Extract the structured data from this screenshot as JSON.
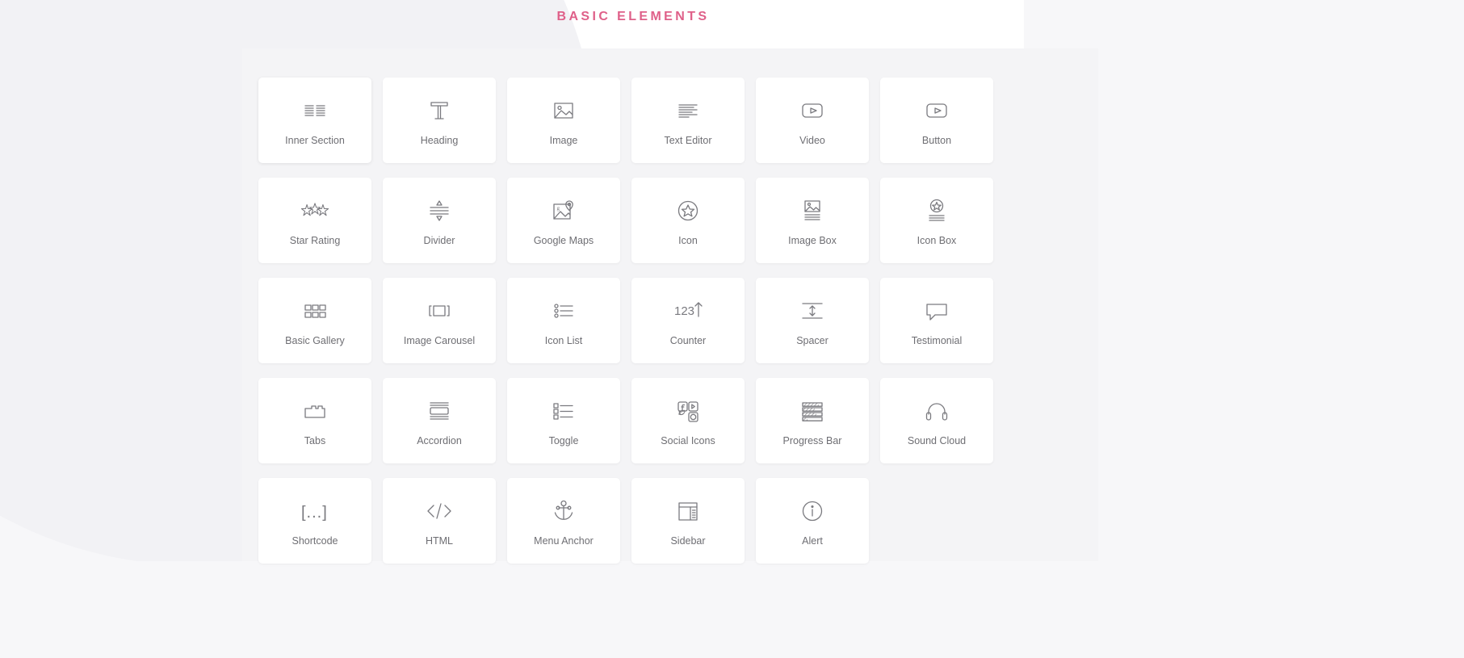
{
  "header": {
    "title": "BASIC ELEMENTS",
    "title_color": "#df6089"
  },
  "theme": {
    "card_background": "#ffffff",
    "page_background": "#f7f7f9",
    "label_color": "#6e6e73",
    "icon_color": "#7a7a7f"
  },
  "grid": {
    "columns": 6,
    "rows": 5,
    "items": [
      {
        "label": "Inner Section",
        "icon": "inner-section-icon"
      },
      {
        "label": "Heading",
        "icon": "heading-icon"
      },
      {
        "label": "Image",
        "icon": "image-icon"
      },
      {
        "label": "Text Editor",
        "icon": "text-editor-icon"
      },
      {
        "label": "Video",
        "icon": "video-icon"
      },
      {
        "label": "Button",
        "icon": "button-icon"
      },
      {
        "label": "Star Rating",
        "icon": "star-rating-icon"
      },
      {
        "label": "Divider",
        "icon": "divider-icon"
      },
      {
        "label": "Google Maps",
        "icon": "google-maps-icon"
      },
      {
        "label": "Icon",
        "icon": "icon-star-circle-icon"
      },
      {
        "label": "Image Box",
        "icon": "image-box-icon"
      },
      {
        "label": "Icon Box",
        "icon": "icon-box-icon"
      },
      {
        "label": "Basic Gallery",
        "icon": "basic-gallery-icon"
      },
      {
        "label": "Image Carousel",
        "icon": "image-carousel-icon"
      },
      {
        "label": "Icon List",
        "icon": "icon-list-icon"
      },
      {
        "label": "Counter",
        "icon": "counter-icon"
      },
      {
        "label": "Spacer",
        "icon": "spacer-icon"
      },
      {
        "label": "Testimonial",
        "icon": "testimonial-icon"
      },
      {
        "label": "Tabs",
        "icon": "tabs-icon"
      },
      {
        "label": "Accordion",
        "icon": "accordion-icon"
      },
      {
        "label": "Toggle",
        "icon": "toggle-icon"
      },
      {
        "label": "Social Icons",
        "icon": "social-icons-icon"
      },
      {
        "label": "Progress Bar",
        "icon": "progress-bar-icon"
      },
      {
        "label": "Sound Cloud",
        "icon": "sound-cloud-icon"
      },
      {
        "label": "Shortcode",
        "icon": "shortcode-icon"
      },
      {
        "label": "HTML",
        "icon": "html-icon"
      },
      {
        "label": "Menu Anchor",
        "icon": "menu-anchor-icon"
      },
      {
        "label": "Sidebar",
        "icon": "sidebar-icon"
      },
      {
        "label": "Alert",
        "icon": "alert-icon"
      }
    ]
  },
  "icon_glyphs": {
    "counter_text": "123",
    "shortcode_text": "[...]",
    "html_text": "</>"
  }
}
